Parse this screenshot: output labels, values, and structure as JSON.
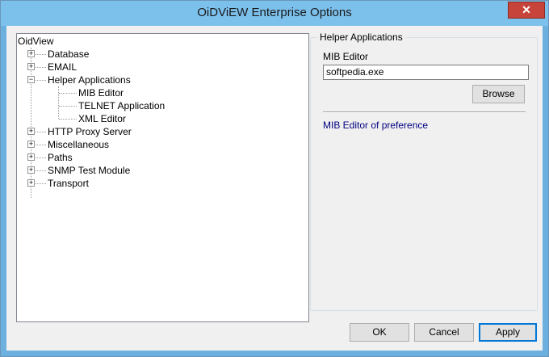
{
  "window": {
    "title": "OiDViEW Enterprise Options",
    "close_glyph": "✕"
  },
  "tree": {
    "root": "OidView",
    "items": [
      {
        "label": "Database",
        "expander": "+"
      },
      {
        "label": "EMAIL",
        "expander": "+"
      },
      {
        "label": "Helper Applications",
        "expander": "−"
      },
      {
        "label": "MIB Editor"
      },
      {
        "label": "TELNET Application"
      },
      {
        "label": "XML Editor"
      },
      {
        "label": "HTTP Proxy Server",
        "expander": "+"
      },
      {
        "label": "Miscellaneous",
        "expander": "+"
      },
      {
        "label": "Paths",
        "expander": "+"
      },
      {
        "label": "SNMP Test Module",
        "expander": "+"
      },
      {
        "label": "Transport",
        "expander": "+"
      }
    ]
  },
  "panel": {
    "group_title": "Helper Applications",
    "field_label": "MIB Editor",
    "field_value": "softpedia.exe",
    "browse_label": "Browse",
    "description": "MIB Editor of preference"
  },
  "footer": {
    "ok": "OK",
    "cancel": "Cancel",
    "apply": "Apply"
  }
}
